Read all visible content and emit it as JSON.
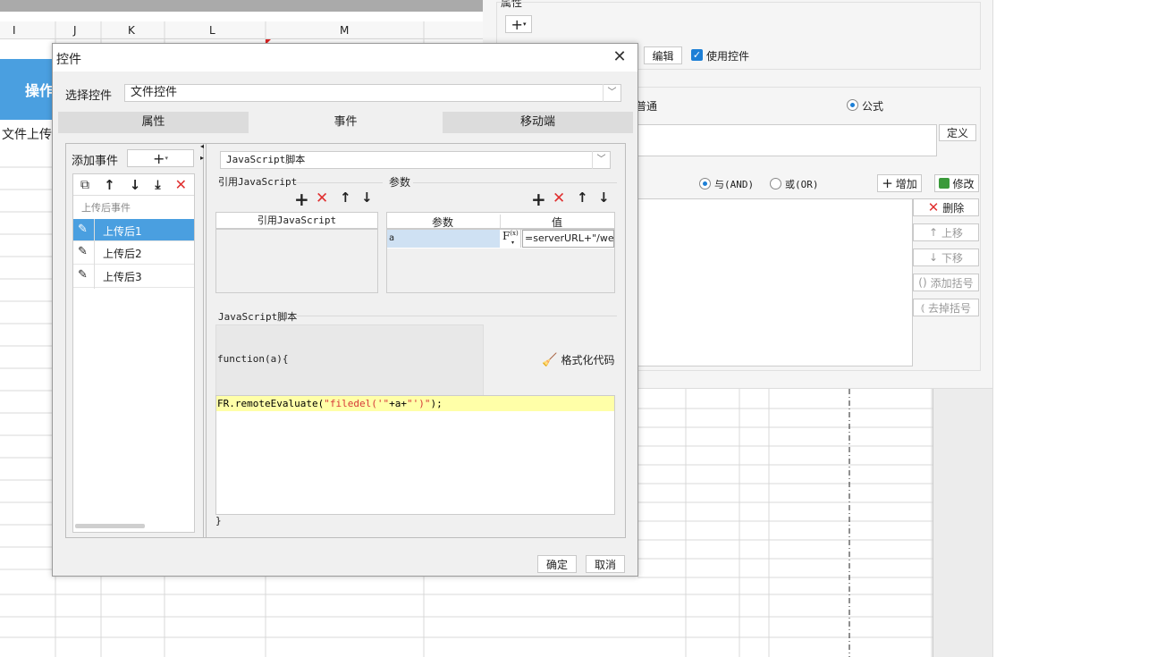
{
  "sheet": {
    "columns": [
      "I",
      "J",
      "K",
      "L",
      "M"
    ],
    "cell_header": "操作",
    "cell_upload": "文件上传"
  },
  "right_panel": {
    "property_title": "属性",
    "edit_label": "编辑",
    "use_widget_label": "使用控件",
    "normal_label": "普通",
    "formula_label": "公式",
    "define_label": "定义",
    "and_label": "与(AND)",
    "or_label": "或(OR)",
    "add_label": "增加",
    "modify_label": "修改",
    "delete_label": "删除",
    "moveup_label": "上移",
    "movedown_label": "下移",
    "add_bracket_label": "添加括号",
    "remove_bracket_label": "去掉括号"
  },
  "dialog": {
    "title": "控件",
    "select_label": "选择控件",
    "select_value": "文件控件",
    "tabs": [
      "属性",
      "事件",
      "移动端"
    ],
    "add_event_label": "添加事件",
    "event_group": "上传后事件",
    "events": [
      "上传后1",
      "上传后2",
      "上传后3"
    ],
    "script_type": "JavaScript脚本",
    "ref_js_label": "引用JavaScript",
    "params_label": "参数",
    "ref_js_col": "引用JavaScript",
    "param_col": "参数",
    "value_col": "值",
    "param_row": {
      "name": "a",
      "value": "=serverURL+\"/we"
    },
    "script_section": "JavaScript脚本",
    "function_sig": "function(a){",
    "format_label": "格式化代码",
    "code_line": {
      "p1": "FR.remoteEvaluate(",
      "p2": "\"filedel('\"",
      "p3": "+a+",
      "p4": "\"')\"",
      "p5": ");"
    },
    "closing_brace": "}",
    "ok_label": "确定",
    "cancel_label": "取消"
  }
}
